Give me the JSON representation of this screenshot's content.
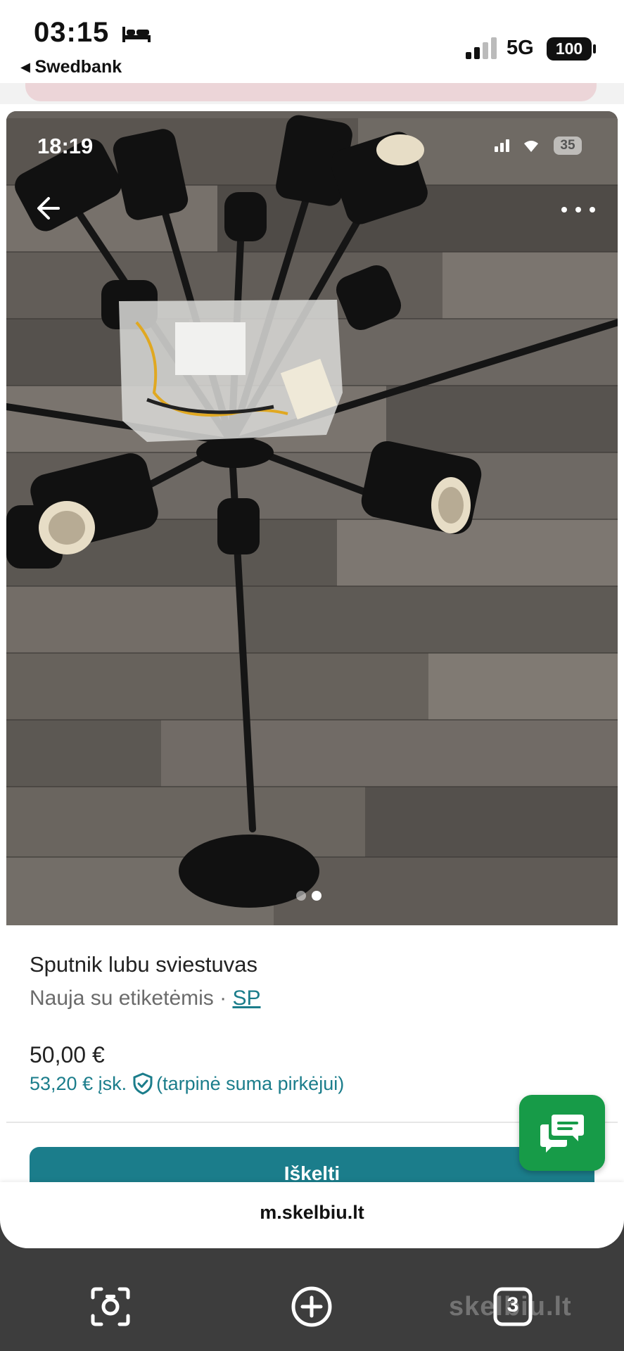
{
  "status_bar": {
    "time": "03:15",
    "back_app": "◂ Swedbank",
    "network": "5G",
    "battery": "100"
  },
  "screenshot_status": {
    "time": "18:19",
    "battery": "35"
  },
  "listing": {
    "title": "Sputnik lubu sviestuvas",
    "condition": "Nauja su etiketėmis",
    "separator": " · ",
    "seller_link": "SP",
    "price": "50,00 €",
    "total_price": "53,20 € įsk.",
    "total_note": "(tarpinė suma pirkėjui)",
    "photo_count": 2,
    "active_photo": 2
  },
  "cta": {
    "label": "Iškelti"
  },
  "browser": {
    "url": "m.skelbiu.lt"
  },
  "watermark": "skelbiu.lt",
  "toolbar": {
    "tabs_count": "3"
  },
  "colors": {
    "accent": "#1b7d8b",
    "chat_green": "#179b48"
  }
}
